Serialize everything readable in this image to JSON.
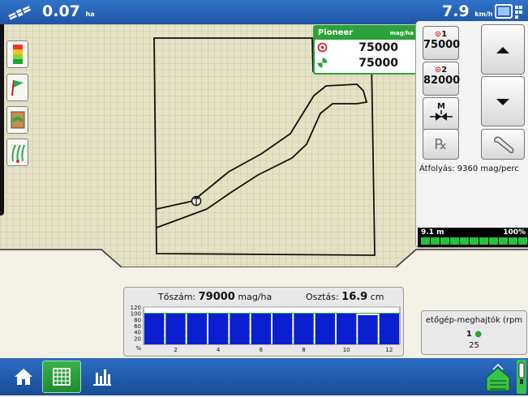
{
  "status_bar": {
    "area_value": "0.07",
    "area_unit": "ha",
    "speed_value": "7.9",
    "speed_unit": "km/h"
  },
  "seed_box": {
    "title": "Pioneer",
    "unit": "mag/ha",
    "target_rate": "75000",
    "actual_rate": "75000",
    "accent_color": "#2ba33a"
  },
  "rate_panel": {
    "rate1_label": "1",
    "rate1_value": "75000",
    "rate2_label": "2",
    "rate2_value": "82000",
    "flow_text": "Átfolyás: 9360 mag/perc",
    "prescription_symbol": "℞"
  },
  "implement_bar": {
    "width_text": "9.1 m",
    "percent_text": "100%",
    "sections_active": 1.0
  },
  "population_chart": {
    "pop_label": "Tőszám:",
    "pop_value": "79000",
    "pop_unit": "mag/ha",
    "spacing_label": "Osztás:",
    "spacing_value": "16.9",
    "spacing_unit": "cm",
    "y_ticks": [
      "120",
      "100",
      "80",
      "60",
      "40",
      "20",
      "%"
    ],
    "x_ticks": [
      "2",
      "4",
      "6",
      "8",
      "10",
      "12"
    ],
    "row_values": [
      100,
      100,
      100,
      100,
      100,
      100,
      100,
      100,
      100,
      100,
      94,
      100
    ],
    "bar_color": "#0a1fcf"
  },
  "drive_box": {
    "title": "etőgép-meghajtók (rpm",
    "drive_num": "1",
    "drive_value": "25"
  },
  "taskbar": {
    "home": "home-icon",
    "map": "grid-map-icon",
    "chart": "bar-chart-icon"
  }
}
